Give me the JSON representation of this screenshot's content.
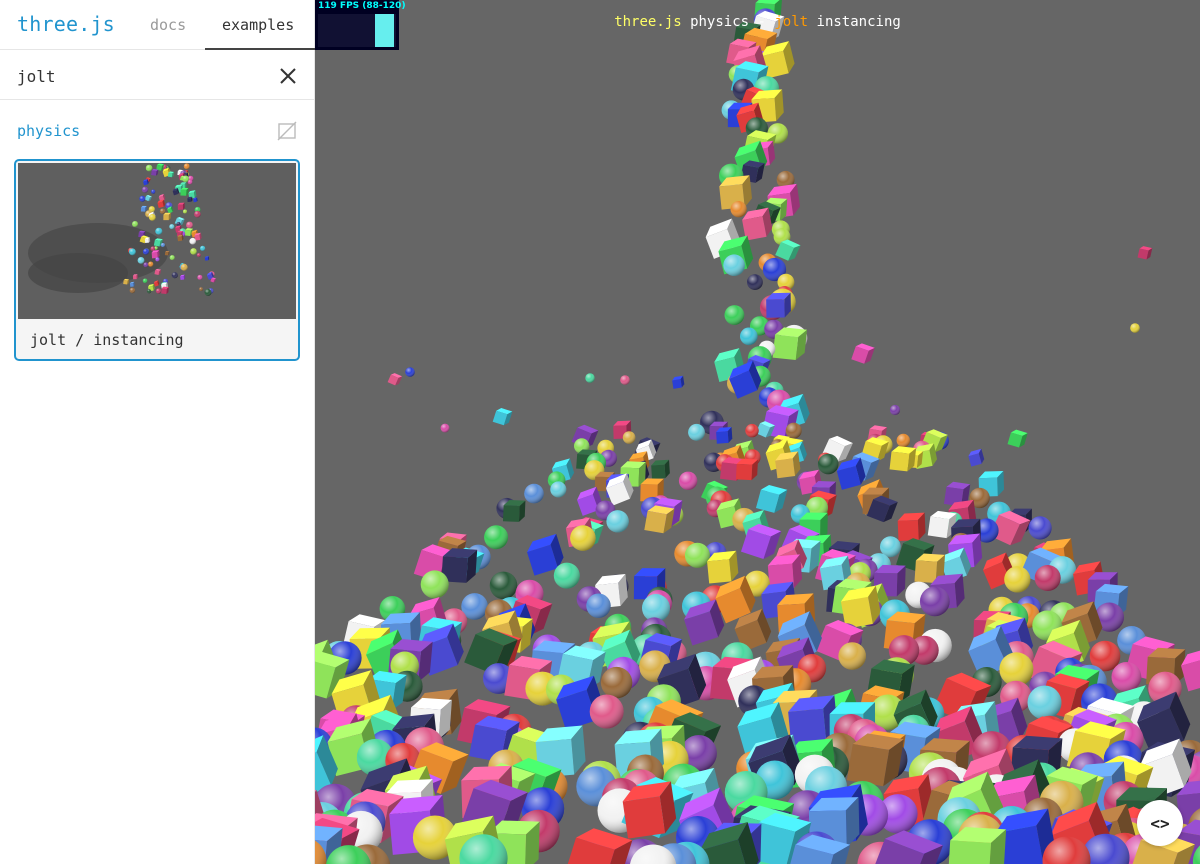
{
  "header": {
    "logo": "three.js",
    "tabs": [
      {
        "label": "docs",
        "active": false
      },
      {
        "label": "examples",
        "active": true
      }
    ]
  },
  "filter": {
    "value": "jolt",
    "clear_icon": "close-icon"
  },
  "category": {
    "label": "physics",
    "toggle_icon": "preview-off-icon"
  },
  "example_card": {
    "label": "jolt / instancing",
    "selected": true
  },
  "stats": {
    "text": "119 FPS (88-120)",
    "fps": 119
  },
  "info": {
    "link": "three.js",
    "text": "physics -",
    "highlight": "jolt",
    "suffix": "instancing"
  },
  "code_button": {
    "label": "<>"
  },
  "colors": {
    "accent": "#2194ce",
    "viewport_bg": "#666666",
    "stats_text": "#00ffff",
    "info_link": "#ffff66",
    "info_highlight": "#ff9900"
  }
}
